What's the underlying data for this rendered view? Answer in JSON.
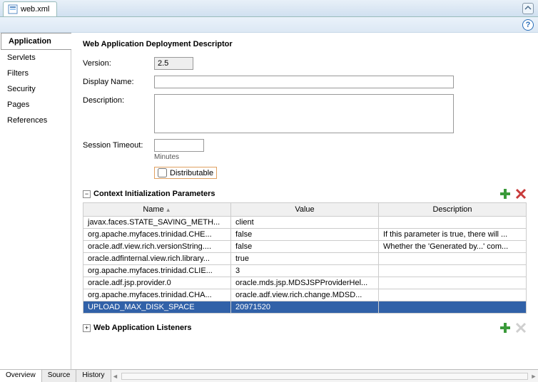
{
  "editor": {
    "tab_label": "web.xml"
  },
  "sidebar": {
    "items": [
      {
        "label": "Application"
      },
      {
        "label": "Servlets"
      },
      {
        "label": "Filters"
      },
      {
        "label": "Security"
      },
      {
        "label": "Pages"
      },
      {
        "label": "References"
      }
    ]
  },
  "page": {
    "title": "Web Application Deployment Descriptor",
    "version_label": "Version:",
    "version_value": "2.5",
    "display_name_label": "Display Name:",
    "display_name_value": "",
    "description_label": "Description:",
    "description_value": "",
    "session_timeout_label": "Session Timeout:",
    "session_timeout_value": "",
    "minutes_label": "Minutes",
    "distributable_label": "Distributable"
  },
  "params_section": {
    "title": "Context Initialization Parameters",
    "columns": {
      "name": "Name",
      "value": "Value",
      "description": "Description"
    },
    "rows": [
      {
        "name": "javax.faces.STATE_SAVING_METH...",
        "value": "client",
        "description": ""
      },
      {
        "name": "org.apache.myfaces.trinidad.CHE...",
        "value": "false",
        "description": "If this parameter is true, there will ..."
      },
      {
        "name": "oracle.adf.view.rich.versionString....",
        "value": "false",
        "description": "Whether the 'Generated by...' com..."
      },
      {
        "name": "oracle.adfinternal.view.rich.library...",
        "value": "true",
        "description": ""
      },
      {
        "name": "org.apache.myfaces.trinidad.CLIE...",
        "value": "3",
        "description": ""
      },
      {
        "name": "oracle.adf.jsp.provider.0",
        "value": "oracle.mds.jsp.MDSJSPProviderHel...",
        "description": ""
      },
      {
        "name": "org.apache.myfaces.trinidad.CHA...",
        "value": "oracle.adf.view.rich.change.MDSD...",
        "description": ""
      },
      {
        "name": "UPLOAD_MAX_DISK_SPACE",
        "value": "20971520",
        "description": ""
      }
    ]
  },
  "listeners_section": {
    "title": "Web Application Listeners"
  },
  "bottom_tabs": {
    "overview": "Overview",
    "source": "Source",
    "history": "History"
  }
}
